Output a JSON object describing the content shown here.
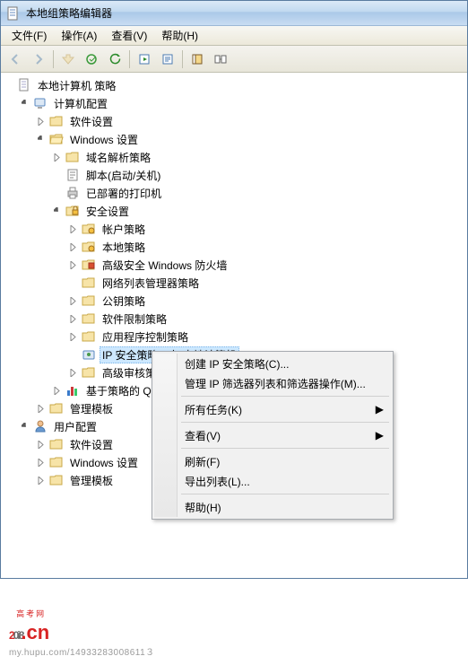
{
  "window": {
    "title": "本地组策略编辑器"
  },
  "menu": {
    "file": "文件(F)",
    "action": "操作(A)",
    "view": "查看(V)",
    "help": "帮助(H)"
  },
  "tree": {
    "root": "本地计算机 策略",
    "computer": "计算机配置",
    "software": "软件设置",
    "windows": "Windows 设置",
    "dns": "域名解析策略",
    "script": "脚本(启动/关机)",
    "printers": "已部署的打印机",
    "security": "安全设置",
    "account": "帐户策略",
    "local": "本地策略",
    "firewall": "高级安全 Windows 防火墙",
    "netlist": "网络列表管理器策略",
    "pubkey": "公钥策略",
    "softrest": "软件限制策略",
    "appctrl": "应用程序控制策略",
    "ipsec": "IP 安全策略，在 本地计算机",
    "audit": "高级审核策",
    "qos": "基于策略的 Q",
    "admintpl": "管理模板",
    "user": "用户配置",
    "usoftware": "软件设置",
    "uwindows": "Windows 设置",
    "uadmintpl": "管理模板"
  },
  "context": {
    "create": "创建 IP 安全策略(C)...",
    "manage": "管理 IP 筛选器列表和筛选器操作(M)...",
    "alltasks": "所有任务(K)",
    "view": "查看(V)",
    "refresh": "刷新(F)",
    "export": "导出列表(L)...",
    "help": "帮助(H)"
  },
  "watermark": {
    "y1": "2",
    "y2": "0i8",
    "cn": ".cn",
    "tag": "高考网",
    "url": "my.hupu.com/14933283008611３"
  }
}
